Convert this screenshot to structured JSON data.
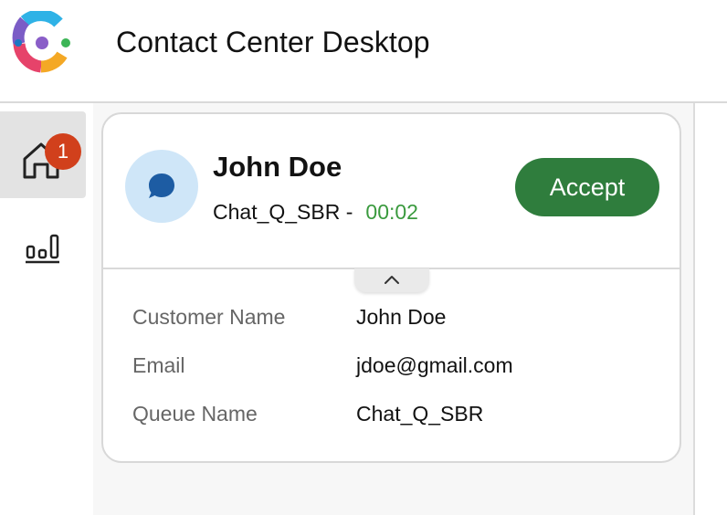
{
  "header": {
    "app_title": "Contact Center Desktop",
    "logo_icon": "webex-contact-center-logo"
  },
  "sidebar": {
    "items": [
      {
        "name": "home",
        "icon": "home-icon",
        "badge": "1",
        "selected": true
      },
      {
        "name": "statistics",
        "icon": "bar-chart-icon",
        "selected": false
      }
    ]
  },
  "task_card": {
    "customer_title": "John Doe",
    "queue_label": "Chat_Q_SBR -",
    "timer": "00:02",
    "channel_icon": "chat-bubble-icon",
    "accept_label": "Accept",
    "collapse_icon": "chevron-up-icon",
    "details": [
      {
        "label": "Customer Name",
        "value": "John Doe"
      },
      {
        "label": "Email",
        "value": "jdoe@gmail.com"
      },
      {
        "label": "Queue Name",
        "value": "Chat_Q_SBR"
      }
    ]
  },
  "colors": {
    "accept_button": "#2f7d3d",
    "timer_text": "#3a9a3e",
    "badge": "#d1401c",
    "avatar_bg": "#cfe6f8",
    "chat_icon": "#1d5ca3"
  }
}
